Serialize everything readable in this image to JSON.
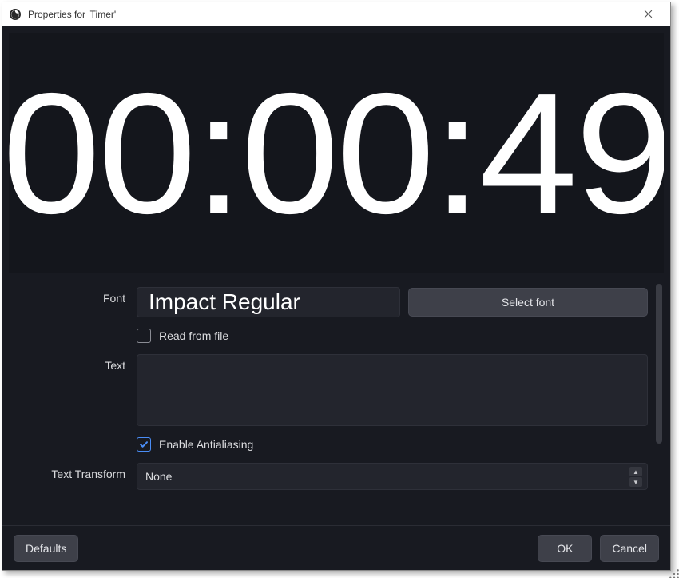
{
  "window": {
    "title": "Properties for 'Timer'"
  },
  "preview": {
    "text": "00:00:49"
  },
  "props": {
    "font_label": "Font",
    "font_value": "Impact Regular",
    "select_font_button": "Select font",
    "read_from_file_label": "Read from file",
    "read_from_file_checked": false,
    "text_label": "Text",
    "text_value": "",
    "enable_antialiasing_label": "Enable Antialiasing",
    "enable_antialiasing_checked": true,
    "text_transform_label": "Text Transform",
    "text_transform_value": "None"
  },
  "footer": {
    "defaults": "Defaults",
    "ok": "OK",
    "cancel": "Cancel"
  }
}
